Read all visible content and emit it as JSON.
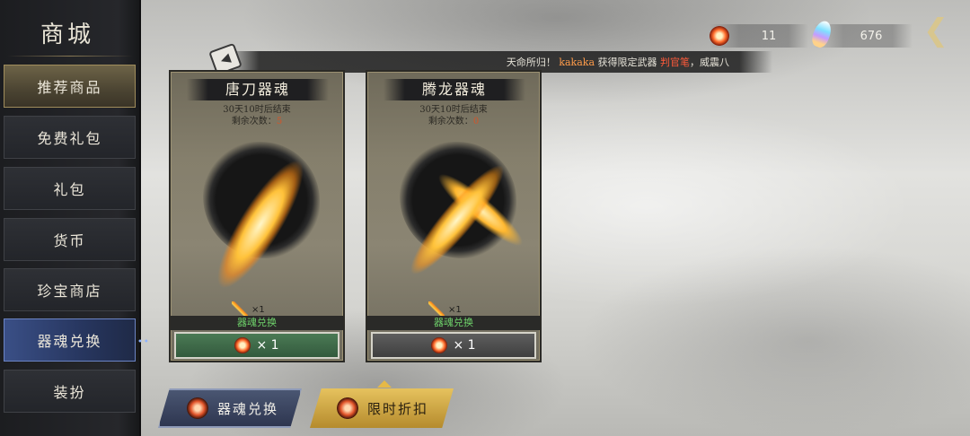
{
  "sidebar": {
    "title": "商城",
    "items": [
      {
        "label": "推荐商品"
      },
      {
        "label": "免费礼包"
      },
      {
        "label": "礼包"
      },
      {
        "label": "货币"
      },
      {
        "label": "珍宝商店"
      },
      {
        "label": "器魂兑换"
      },
      {
        "label": "装扮"
      }
    ]
  },
  "currencies": [
    {
      "icon": "weapon-soul-token-icon",
      "value": "11"
    },
    {
      "icon": "rainbow-feather-icon",
      "value": "676"
    }
  ],
  "banner": {
    "prefix": "天命所归！",
    "player": "kakaka",
    "middle": "获得限定武器",
    "item": "判官笔",
    "suffix": "，威震八"
  },
  "cards": [
    {
      "title": "唐刀器魂",
      "time_left": "30天10时后结束",
      "remaining_label": "剩余次数：",
      "remaining": "5",
      "reward_count": "×1",
      "label": "器魂兑换",
      "cost": "× 1",
      "button_style": "green"
    },
    {
      "title": "腾龙器魂",
      "time_left": "30天10时后结束",
      "remaining_label": "剩余次数：",
      "remaining": "0",
      "reward_count": "×1",
      "label": "器魂兑换",
      "cost": "× 1",
      "button_style": "gray"
    }
  ],
  "bottom_tabs": [
    {
      "label": "器魂兑换"
    },
    {
      "label": "限时折扣"
    }
  ],
  "colors": {
    "active_green": "#4b7a55",
    "discount_gold": "#e6c25e",
    "highlight_orange": "#ff9c4a"
  }
}
